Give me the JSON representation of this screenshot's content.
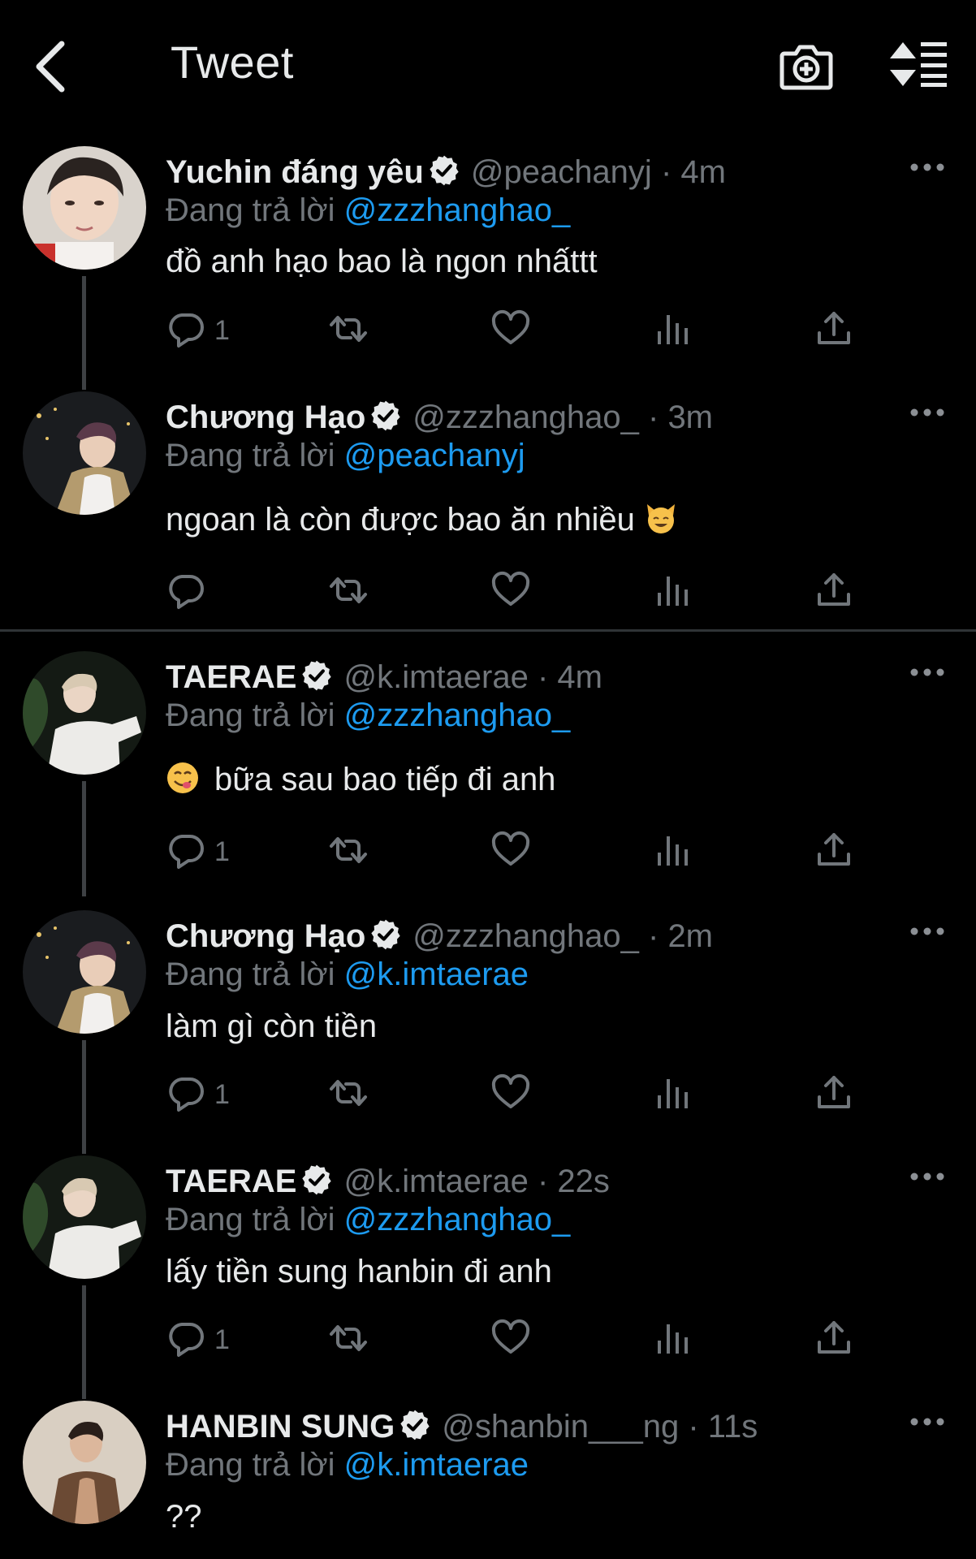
{
  "header": {
    "title": "Tweet",
    "back_icon": "chevron-left-icon",
    "camera_icon": "camera-plus-icon",
    "sort_icon": "sort-icon"
  },
  "colors": {
    "background": "#000000",
    "text": "#e7e9ea",
    "muted": "#71767b",
    "link": "#1d9bf0",
    "separator": "#2f3336"
  },
  "tweets": [
    {
      "display_name": "Yuchin đáng yêu",
      "handle": "@peachanyj",
      "time": "4m",
      "reply_label": "Đang trả lời",
      "reply_to": "@zzzhanghao_",
      "text": "đồ anh hạo bao là ngon nhấttt",
      "reply_count": "1"
    },
    {
      "display_name": "Chương Hạo",
      "handle": "@zzzhanghao_",
      "time": "3m",
      "reply_label": "Đang trả lời",
      "reply_to": "@peachanyj",
      "text": "ngoan là còn được bao ăn nhiều",
      "reply_count": ""
    },
    {
      "display_name": "TAERAE",
      "handle": "@k.imtaerae",
      "time": "4m",
      "reply_label": "Đang trả lời",
      "reply_to": "@zzzhanghao_",
      "text": "bữa sau bao tiếp đi anh",
      "reply_count": "1"
    },
    {
      "display_name": "Chương Hạo",
      "handle": "@zzzhanghao_",
      "time": "2m",
      "reply_label": "Đang trả lời",
      "reply_to": "@k.imtaerae",
      "text": "làm gì còn tiền",
      "reply_count": "1"
    },
    {
      "display_name": "TAERAE",
      "handle": "@k.imtaerae",
      "time": "22s",
      "reply_label": "Đang trả lời",
      "reply_to": "@zzzhanghao_",
      "text": "lấy tiền sung hanbin đi anh",
      "reply_count": "1"
    },
    {
      "display_name": "HANBIN SUNG",
      "handle": "@shanbin___ng",
      "time": "11s",
      "reply_label": "Đang trả lời",
      "reply_to": "@k.imtaerae",
      "text": "??",
      "reply_count": ""
    }
  ],
  "dot": "·"
}
